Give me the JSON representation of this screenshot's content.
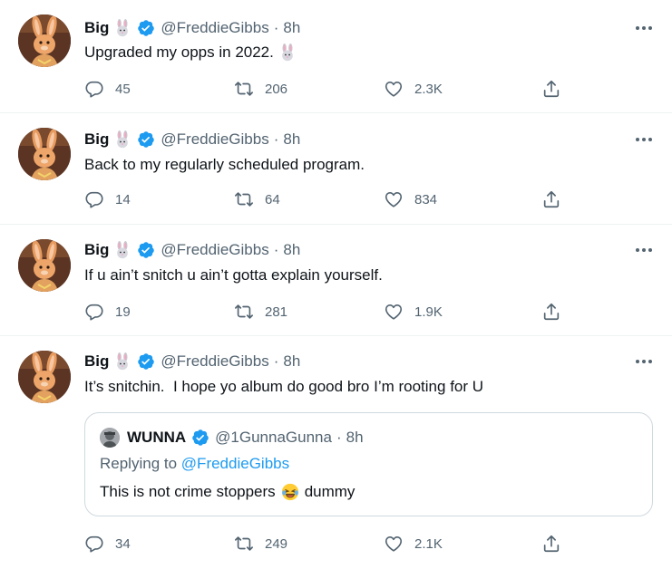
{
  "colors": {
    "accent": "#1d9bf0",
    "secondary_text": "#536471",
    "border": "#cfd9de"
  },
  "icons": {
    "verified": "verified-badge-icon",
    "bunny": "rabbit-face-emoji",
    "reply": "speech-bubble-icon",
    "retweet": "retweet-arrows-icon",
    "like": "heart-icon",
    "share": "share-upload-icon",
    "more": "ellipsis-icon",
    "laugh": "face-with-tears-of-joy-emoji"
  },
  "tweets": [
    {
      "name": "Big",
      "handle": "@FreddieGibbs",
      "dot": "·",
      "time": "8h",
      "text": "Upgraded my opps in 2022.",
      "replies": "45",
      "retweets": "206",
      "likes": "2.3K"
    },
    {
      "name": "Big",
      "handle": "@FreddieGibbs",
      "dot": "·",
      "time": "8h",
      "text": "Back to my regularly scheduled program.",
      "replies": "14",
      "retweets": "64",
      "likes": "834"
    },
    {
      "name": "Big",
      "handle": "@FreddieGibbs",
      "dot": "·",
      "time": "8h",
      "text": "If u ain’t snitch u ain’t gotta explain yourself.",
      "replies": "19",
      "retweets": "281",
      "likes": "1.9K"
    },
    {
      "name": "Big",
      "handle": "@FreddieGibbs",
      "dot": "·",
      "time": "8h",
      "text": "It’s snitchin.  I hope yo album do good bro I’m rooting for U",
      "replies": "34",
      "retweets": "249",
      "likes": "2.1K",
      "quote": {
        "name": "WUNNA",
        "handle": "@1GunnaGunna",
        "dot": "·",
        "time": "8h",
        "replying_prefix": "Replying to",
        "replying_to": "@FreddieGibbs",
        "text_before": "This is not crime stoppers",
        "text_after": "dummy"
      }
    }
  ]
}
